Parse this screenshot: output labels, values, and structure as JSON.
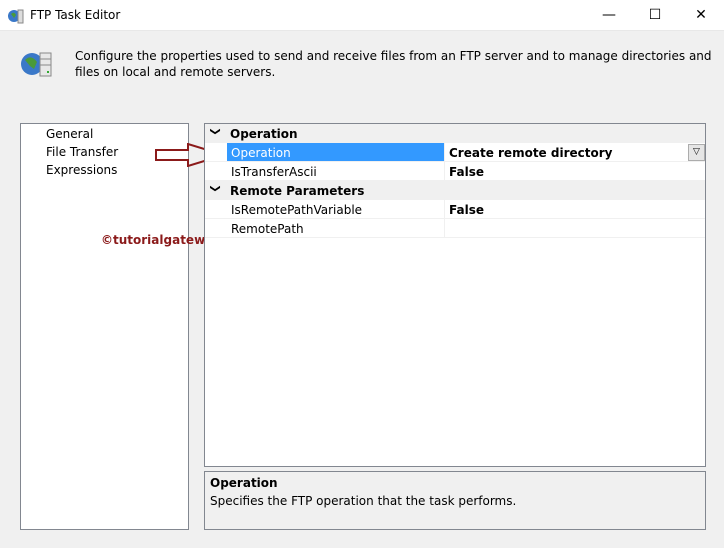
{
  "window": {
    "title": "FTP Task Editor",
    "minimize": "—",
    "maximize": "☐",
    "close": "✕"
  },
  "header": {
    "description": "Configure the properties used to send and receive files from an FTP server and to manage directories and files on local and remote servers."
  },
  "nav": [
    "General",
    "File Transfer",
    "Expressions"
  ],
  "grid": {
    "categories": [
      {
        "label": "Operation",
        "properties": [
          {
            "name": "Operation",
            "value": "Create remote directory"
          },
          {
            "name": "IsTransferAscii",
            "value": "False"
          }
        ]
      },
      {
        "label": "Remote Parameters",
        "properties": [
          {
            "name": "IsRemotePathVariable",
            "value": "False"
          },
          {
            "name": "RemotePath",
            "value": ""
          }
        ]
      }
    ]
  },
  "description_panel": {
    "title": "Operation",
    "text": "Specifies the FTP operation that the task performs."
  },
  "watermark": "©tutorialgateway.org",
  "colors": {
    "selection": "#3399ff",
    "arrow": "#8b1a1a"
  }
}
